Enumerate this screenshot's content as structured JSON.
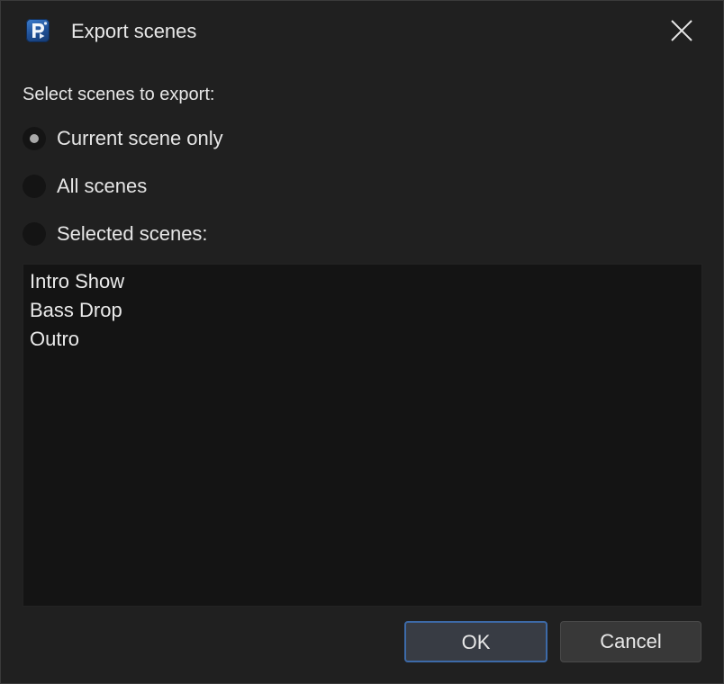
{
  "window": {
    "title": "Export scenes",
    "app_icon": "app-logo-icon",
    "close_icon": "close-icon"
  },
  "export": {
    "section_label": "Select scenes to export:",
    "options": [
      {
        "label": "Current scene only",
        "checked": true
      },
      {
        "label": "All scenes",
        "checked": false
      },
      {
        "label": "Selected scenes:",
        "checked": false
      }
    ],
    "scenes": [
      "Intro Show",
      "Bass Drop",
      "Outro"
    ]
  },
  "buttons": {
    "ok_label": "OK",
    "cancel_label": "Cancel"
  },
  "colors": {
    "background": "#202020",
    "list_background": "#141414",
    "accent": "#3d6aa8"
  }
}
